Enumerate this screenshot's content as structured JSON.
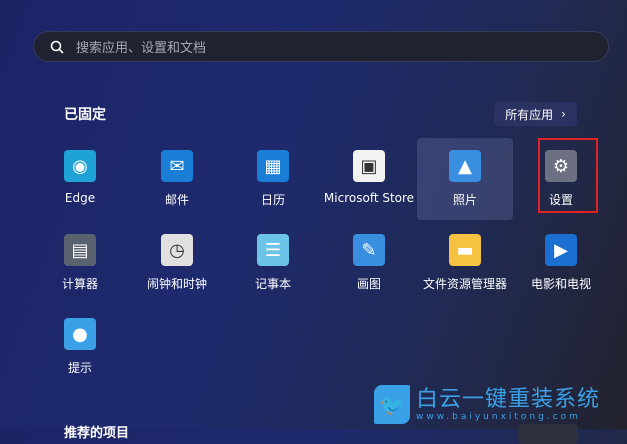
{
  "search": {
    "placeholder": "搜索应用、设置和文档"
  },
  "pinned": {
    "title": "已固定",
    "all_apps": "所有应用",
    "chevron": "›"
  },
  "apps": [
    {
      "label": "Edge",
      "icon": "edge-icon",
      "color": "#1fa3d6"
    },
    {
      "label": "邮件",
      "icon": "mail-icon",
      "color": "#1a7ed6"
    },
    {
      "label": "日历",
      "icon": "calendar-icon",
      "color": "#1a7ed6"
    },
    {
      "label": "Microsoft Store",
      "icon": "store-icon",
      "color": "#f2f2f2"
    },
    {
      "label": "照片",
      "icon": "photos-icon",
      "color": "#3a8ee0"
    },
    {
      "label": "设置",
      "icon": "gear-icon",
      "color": "#6c7080"
    },
    {
      "label": "计算器",
      "icon": "calculator-icon",
      "color": "#5a6270"
    },
    {
      "label": "闹钟和时钟",
      "icon": "clock-icon",
      "color": "#e0e0e0"
    },
    {
      "label": "记事本",
      "icon": "notepad-icon",
      "color": "#6cc4e8"
    },
    {
      "label": "画图",
      "icon": "paint-icon",
      "color": "#3a8ee0"
    },
    {
      "label": "文件资源管理器",
      "icon": "folder-icon",
      "color": "#f5c242"
    },
    {
      "label": "电影和电视",
      "icon": "movies-icon",
      "color": "#1a6fd0"
    },
    {
      "label": "提示",
      "icon": "tips-icon",
      "color": "#3aa1e8"
    }
  ],
  "recommended": {
    "title": "推荐的项目"
  },
  "watermark": {
    "title": "白云一键重装系统",
    "url": "www.baiyunxitong.com"
  }
}
